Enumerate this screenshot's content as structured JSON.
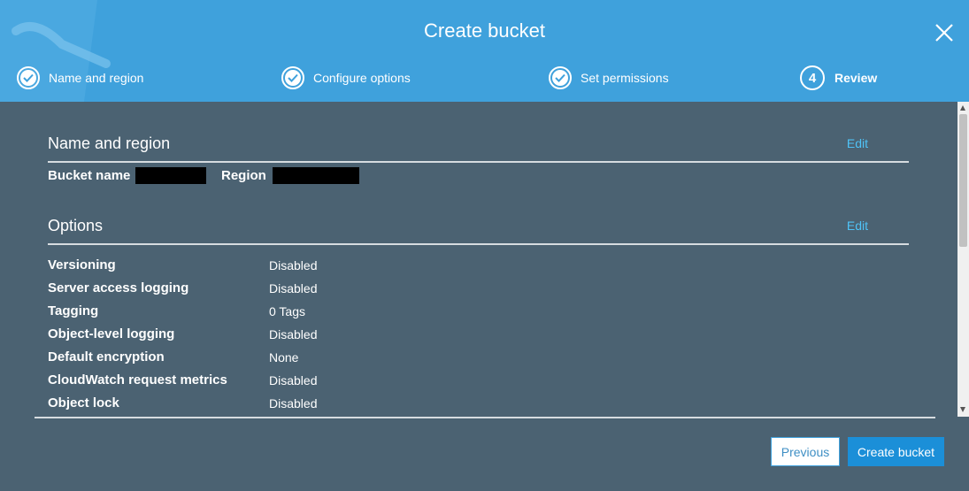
{
  "dialog": {
    "title": "Create bucket"
  },
  "steps": [
    {
      "label": "Name and region",
      "state": "done"
    },
    {
      "label": "Configure options",
      "state": "done"
    },
    {
      "label": "Set permissions",
      "state": "done"
    },
    {
      "label": "Review",
      "state": "active",
      "number": "4"
    }
  ],
  "name_region": {
    "heading": "Name and region",
    "edit": "Edit",
    "bucket_name_label": "Bucket name",
    "region_label": "Region"
  },
  "options": {
    "heading": "Options",
    "edit": "Edit",
    "rows": [
      {
        "label": "Versioning",
        "value": "Disabled"
      },
      {
        "label": "Server access logging",
        "value": "Disabled"
      },
      {
        "label": "Tagging",
        "value": "0 Tags"
      },
      {
        "label": "Object-level logging",
        "value": "Disabled"
      },
      {
        "label": "Default encryption",
        "value": "None"
      },
      {
        "label": "CloudWatch request metrics",
        "value": "Disabled"
      },
      {
        "label": "Object lock",
        "value": "Disabled"
      }
    ]
  },
  "footer": {
    "previous": "Previous",
    "create": "Create bucket"
  },
  "colors": {
    "header": "#3fa1dc",
    "body": "#4b6272",
    "link": "#4fc3f7",
    "primary": "#1b8fd8"
  },
  "icons": {
    "close": "close-icon",
    "step_done": "check-circle-icon"
  }
}
